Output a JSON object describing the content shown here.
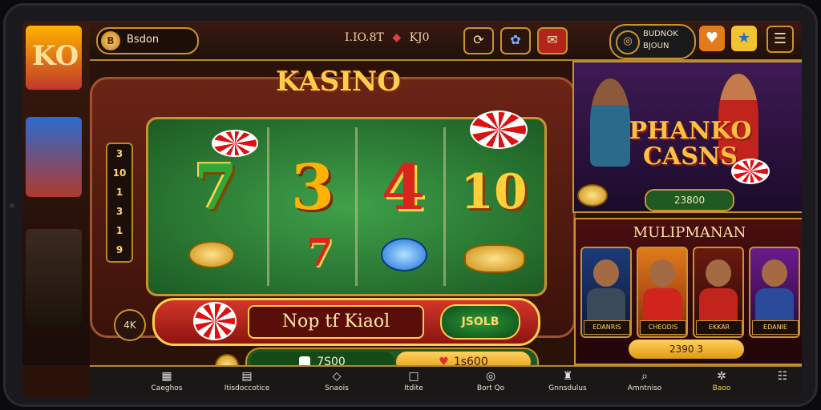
{
  "topbar": {
    "brand_label": "Bsdon",
    "balance_left": "I.IO.8T",
    "balance_right": "KJ0",
    "wallet_line1": "BUDNOK",
    "wallet_line2": "BJOUN"
  },
  "slot": {
    "title": "KASINO",
    "paytable": [
      "3",
      "10",
      "1",
      "3",
      "1",
      "9"
    ],
    "reels": [
      "7",
      "3",
      "4",
      "10"
    ],
    "row2_symbol": "7",
    "spin_label": "Nop tf Kiaol",
    "spin_bonus": "JSOLB",
    "side_button": "4K",
    "stake_left": "7S00",
    "stake_right": "1s600"
  },
  "promo": {
    "title": "PHANKO CASNS",
    "value": "23800"
  },
  "multiplayer": {
    "title": "MULIPMANAN",
    "players": [
      {
        "name": "EDANRIS"
      },
      {
        "name": "CHEODIS"
      },
      {
        "name": "EKKAR"
      },
      {
        "name": "EDANIE"
      }
    ],
    "value": "2390 3"
  },
  "nav": [
    {
      "icon": "gift-icon",
      "label": "Caeghos"
    },
    {
      "icon": "grid-icon",
      "label": "Itisdoccotice"
    },
    {
      "icon": "diamond-icon",
      "label": "Snaois"
    },
    {
      "icon": "square-icon",
      "label": "Itdite"
    },
    {
      "icon": "chip-icon",
      "label": "Bort Qo"
    },
    {
      "icon": "trophy-icon",
      "label": "Gnnsdulus"
    },
    {
      "icon": "search-icon",
      "label": "Amntniso"
    },
    {
      "icon": "settings-icon",
      "label": "Baoo"
    },
    {
      "icon": "profile-icon",
      "label": ""
    }
  ]
}
